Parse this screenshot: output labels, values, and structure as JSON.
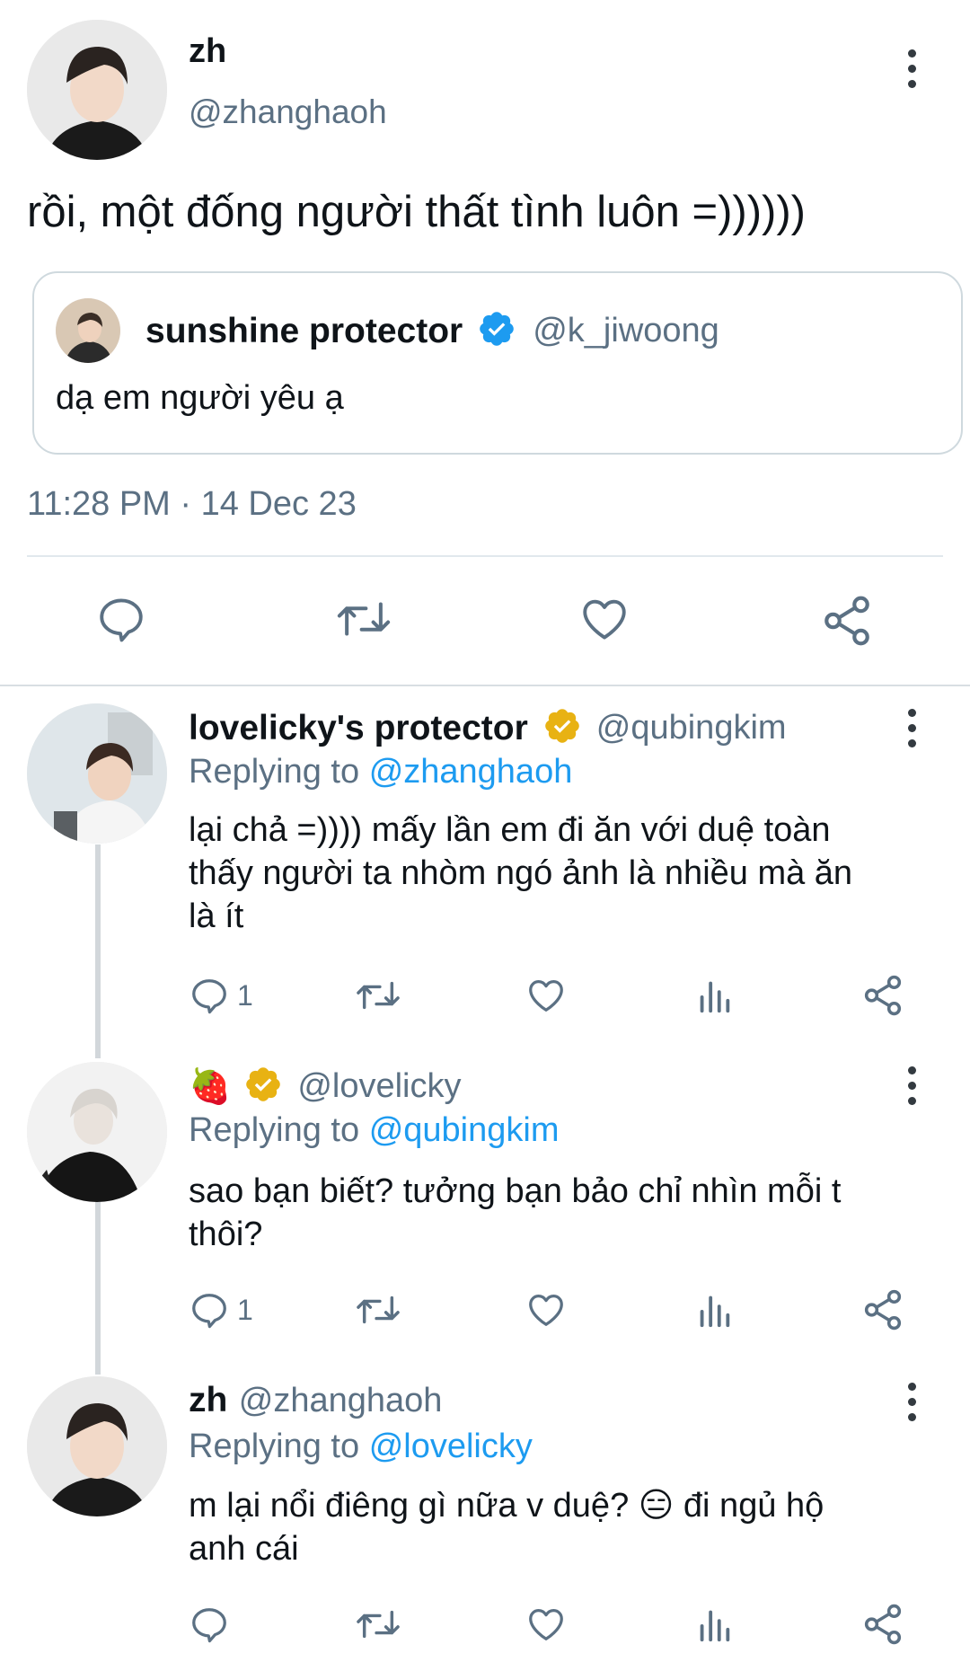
{
  "main_tweet": {
    "name": "zh",
    "handle": "@zhanghaoh",
    "text": "rồi, một đống người thất tình luôn =))))))",
    "timestamp": "11:28 PM · 14 Dec 23",
    "quote": {
      "name": "sunshine protector",
      "handle": "@k_jiwoong",
      "text": "dạ em người yêu ạ"
    }
  },
  "replies": [
    {
      "name": "lovelicky's protector",
      "handle": "@qubingkim",
      "replying_label": "Replying to",
      "replying_to": "@zhanghaoh",
      "text_lines": [
        "lại chả =)))) mấy lần em đi ăn với duệ toàn",
        "thấy người ta nhòm ngó ảnh là nhiều mà ăn",
        "là ít"
      ],
      "reply_count": "1"
    },
    {
      "name_emoji": "🍓",
      "handle": "@lovelicky",
      "replying_label": "Replying to",
      "replying_to": "@qubingkim",
      "text_lines": [
        "sao bạn biết? tưởng bạn bảo chỉ nhìn mỗi t",
        "thôi?"
      ],
      "reply_count": "1"
    },
    {
      "name": "zh",
      "handle": "@zhanghaoh",
      "replying_label": "Replying to",
      "replying_to": "@lovelicky",
      "text_lines": [
        "m lại nổi điêng gì nữa v duệ? 😑 đi ngủ hộ",
        "anh cái"
      ],
      "reply_count": ""
    }
  ],
  "colors": {
    "accent": "#1d9bf0",
    "secondary_text": "#5b7083",
    "gold_badge": "#e8b213"
  }
}
